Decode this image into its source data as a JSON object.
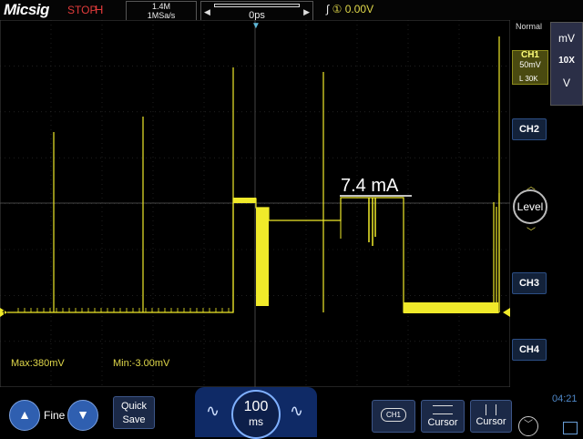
{
  "brand": "Micsig",
  "status": "STOP",
  "horizontal_mode": "H",
  "sampling": {
    "memory": "1.4M",
    "rate": "1MSa/s"
  },
  "trigger_position": "0ps",
  "trigger": {
    "level": "0.00V"
  },
  "acquisition_mode": "Normal",
  "channel1": {
    "label": "CH1",
    "scale": "50mV",
    "coupling": "L 30K",
    "probe": "10X",
    "unit": "mV",
    "unit2": "V"
  },
  "channels": [
    "CH2",
    "CH3",
    "CH4"
  ],
  "level_button": "Level",
  "annotation": "7.4 mA",
  "measurements": {
    "max": "Max:380mV",
    "min": "Min:-3.00mV"
  },
  "bottom": {
    "fine_label": "Fine",
    "quick_save_line1": "Quick",
    "quick_save_line2": "Save",
    "timebase_value": "100",
    "timebase_unit": "ms",
    "ch1_button": "CH1",
    "cursor_h": "Cursor",
    "cursor_v": "Cursor"
  },
  "clock": "04:21",
  "colors": {
    "trace": "#f0ea2a",
    "accent_blue": "#2f5fb0",
    "stop_red": "#e23b3b"
  },
  "icons": [
    "up-arrow-icon",
    "down-arrow-icon",
    "wave-left-icon",
    "wave-right-icon",
    "horizontal-cursor-icon",
    "vertical-cursor-icon",
    "chevron-down-icon"
  ]
}
